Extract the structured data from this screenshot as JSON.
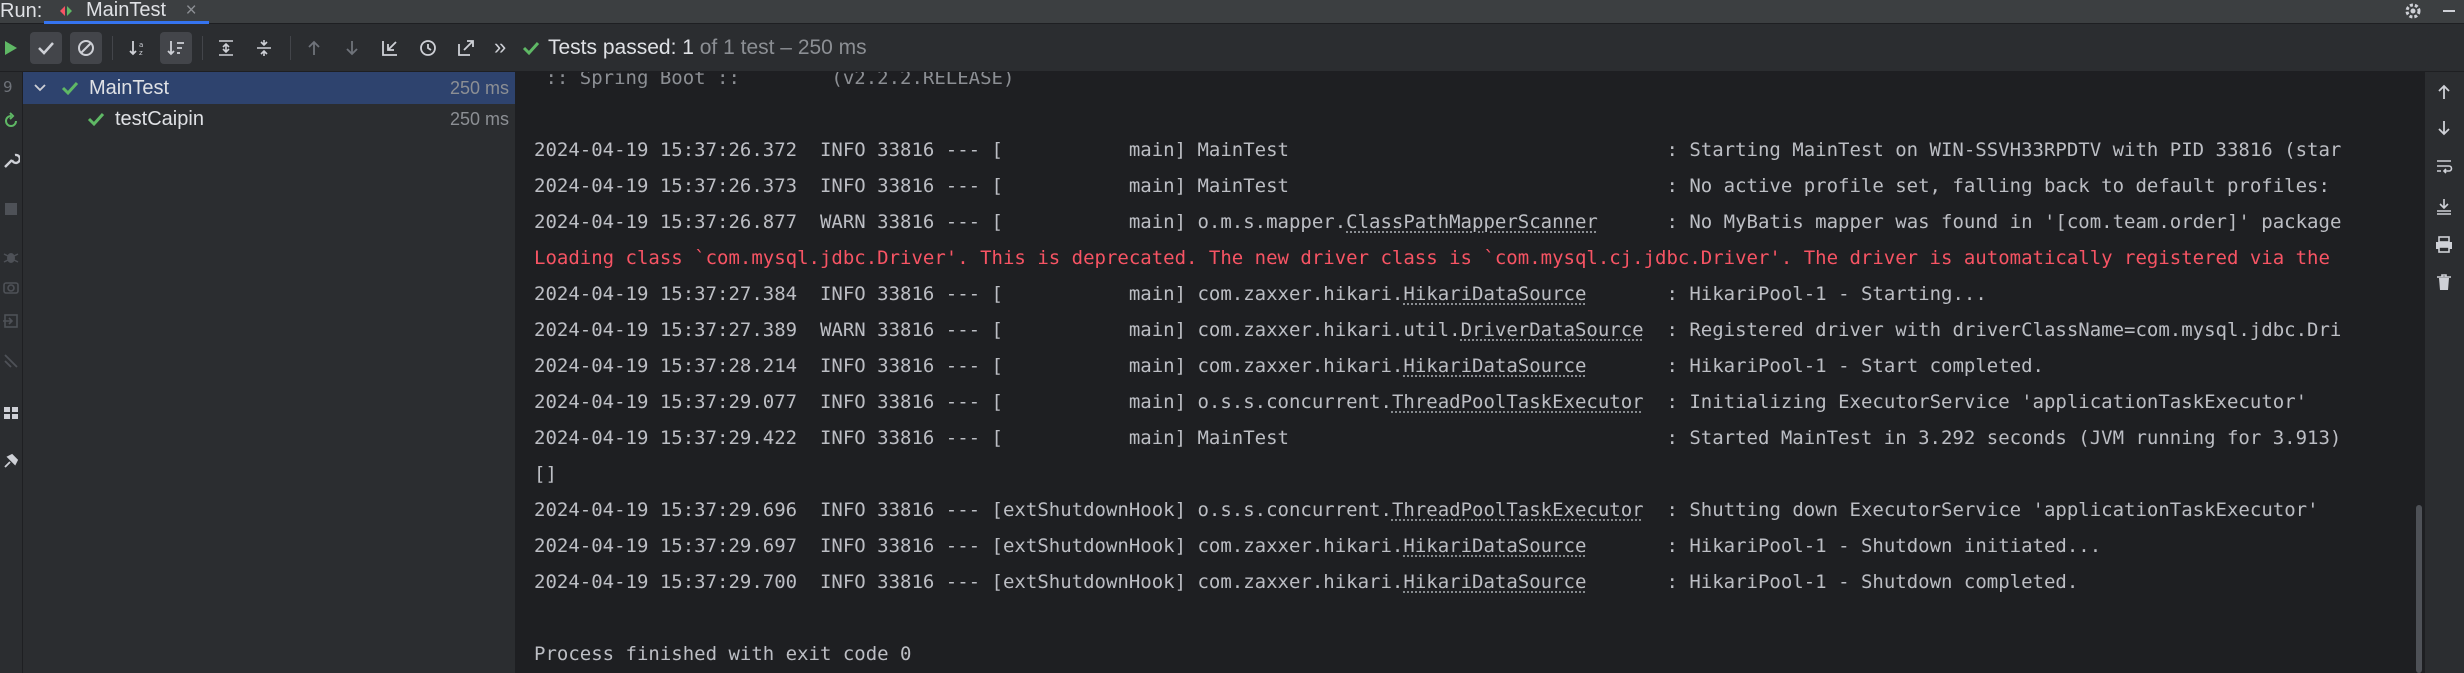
{
  "window": {
    "run_label": "Run:",
    "tab_title": "MainTest",
    "tab_close": "×"
  },
  "toolbar": {
    "status_text": "Tests passed: 1",
    "status_detail": " of 1 test – 250 ms",
    "more": "»"
  },
  "tree": {
    "root": {
      "label": "MainTest",
      "time": "250 ms"
    },
    "child": {
      "label": "testCaipin",
      "time": "250 ms"
    }
  },
  "console": {
    "lines": [
      {
        "kind": "faded",
        "text": " :: Spring Boot ::        (v2.2.2.RELEASE)"
      },
      {
        "kind": "blank",
        "text": ""
      },
      {
        "kind": "plain",
        "text": "2024-04-19 15:37:26.372  INFO 33816 --- [           main] MainTest                                 : Starting MainTest on WIN-SSVH33RPDTV with PID 33816 (star"
      },
      {
        "kind": "plain",
        "text": "2024-04-19 15:37:26.373  INFO 33816 --- [           main] MainTest                                 : No active profile set, falling back to default profiles: "
      },
      {
        "kind": "link",
        "pre": "2024-04-19 15:37:26.877  WARN 33816 --- [           main] o.m.s.mapper.",
        "u": "ClassPathMapperScanner",
        "post": "      : No MyBatis mapper was found in '[com.team.order]' package"
      },
      {
        "kind": "error",
        "text": "Loading class `com.mysql.jdbc.Driver'. This is deprecated. The new driver class is `com.mysql.cj.jdbc.Driver'. The driver is automatically registered via the "
      },
      {
        "kind": "link",
        "pre": "2024-04-19 15:37:27.384  INFO 33816 --- [           main] com.zaxxer.hikari.",
        "u": "HikariDataSource",
        "post": "       : HikariPool-1 - Starting..."
      },
      {
        "kind": "link",
        "pre": "2024-04-19 15:37:27.389  WARN 33816 --- [           main] com.zaxxer.hikari.util.",
        "u": "DriverDataSource",
        "post": "  : Registered driver with driverClassName=com.mysql.jdbc.Dri"
      },
      {
        "kind": "link",
        "pre": "2024-04-19 15:37:28.214  INFO 33816 --- [           main] com.zaxxer.hikari.",
        "u": "HikariDataSource",
        "post": "       : HikariPool-1 - Start completed."
      },
      {
        "kind": "link",
        "pre": "2024-04-19 15:37:29.077  INFO 33816 --- [           main] o.s.s.concurrent.",
        "u": "ThreadPoolTaskExecutor",
        "post": "  : Initializing ExecutorService 'applicationTaskExecutor'"
      },
      {
        "kind": "plain",
        "text": "2024-04-19 15:37:29.422  INFO 33816 --- [           main] MainTest                                 : Started MainTest in 3.292 seconds (JVM running for 3.913)"
      },
      {
        "kind": "plain",
        "text": "[]"
      },
      {
        "kind": "link",
        "pre": "2024-04-19 15:37:29.696  INFO 33816 --- [extShutdownHook] o.s.s.concurrent.",
        "u": "ThreadPoolTaskExecutor",
        "post": "  : Shutting down ExecutorService 'applicationTaskExecutor'"
      },
      {
        "kind": "link",
        "pre": "2024-04-19 15:37:29.697  INFO 33816 --- [extShutdownHook] com.zaxxer.hikari.",
        "u": "HikariDataSource",
        "post": "       : HikariPool-1 - Shutdown initiated..."
      },
      {
        "kind": "link",
        "pre": "2024-04-19 15:37:29.700  INFO 33816 --- [extShutdownHook] com.zaxxer.hikari.",
        "u": "HikariDataSource",
        "post": "       : HikariPool-1 - Shutdown completed."
      },
      {
        "kind": "blank",
        "text": ""
      },
      {
        "kind": "plain",
        "text": "Process finished with exit code 0"
      }
    ]
  },
  "colors": {
    "pass_green": "#5fb865",
    "error_red": "#f75464",
    "selection_blue": "#2e436e",
    "tab_accent": "#3574f0"
  }
}
